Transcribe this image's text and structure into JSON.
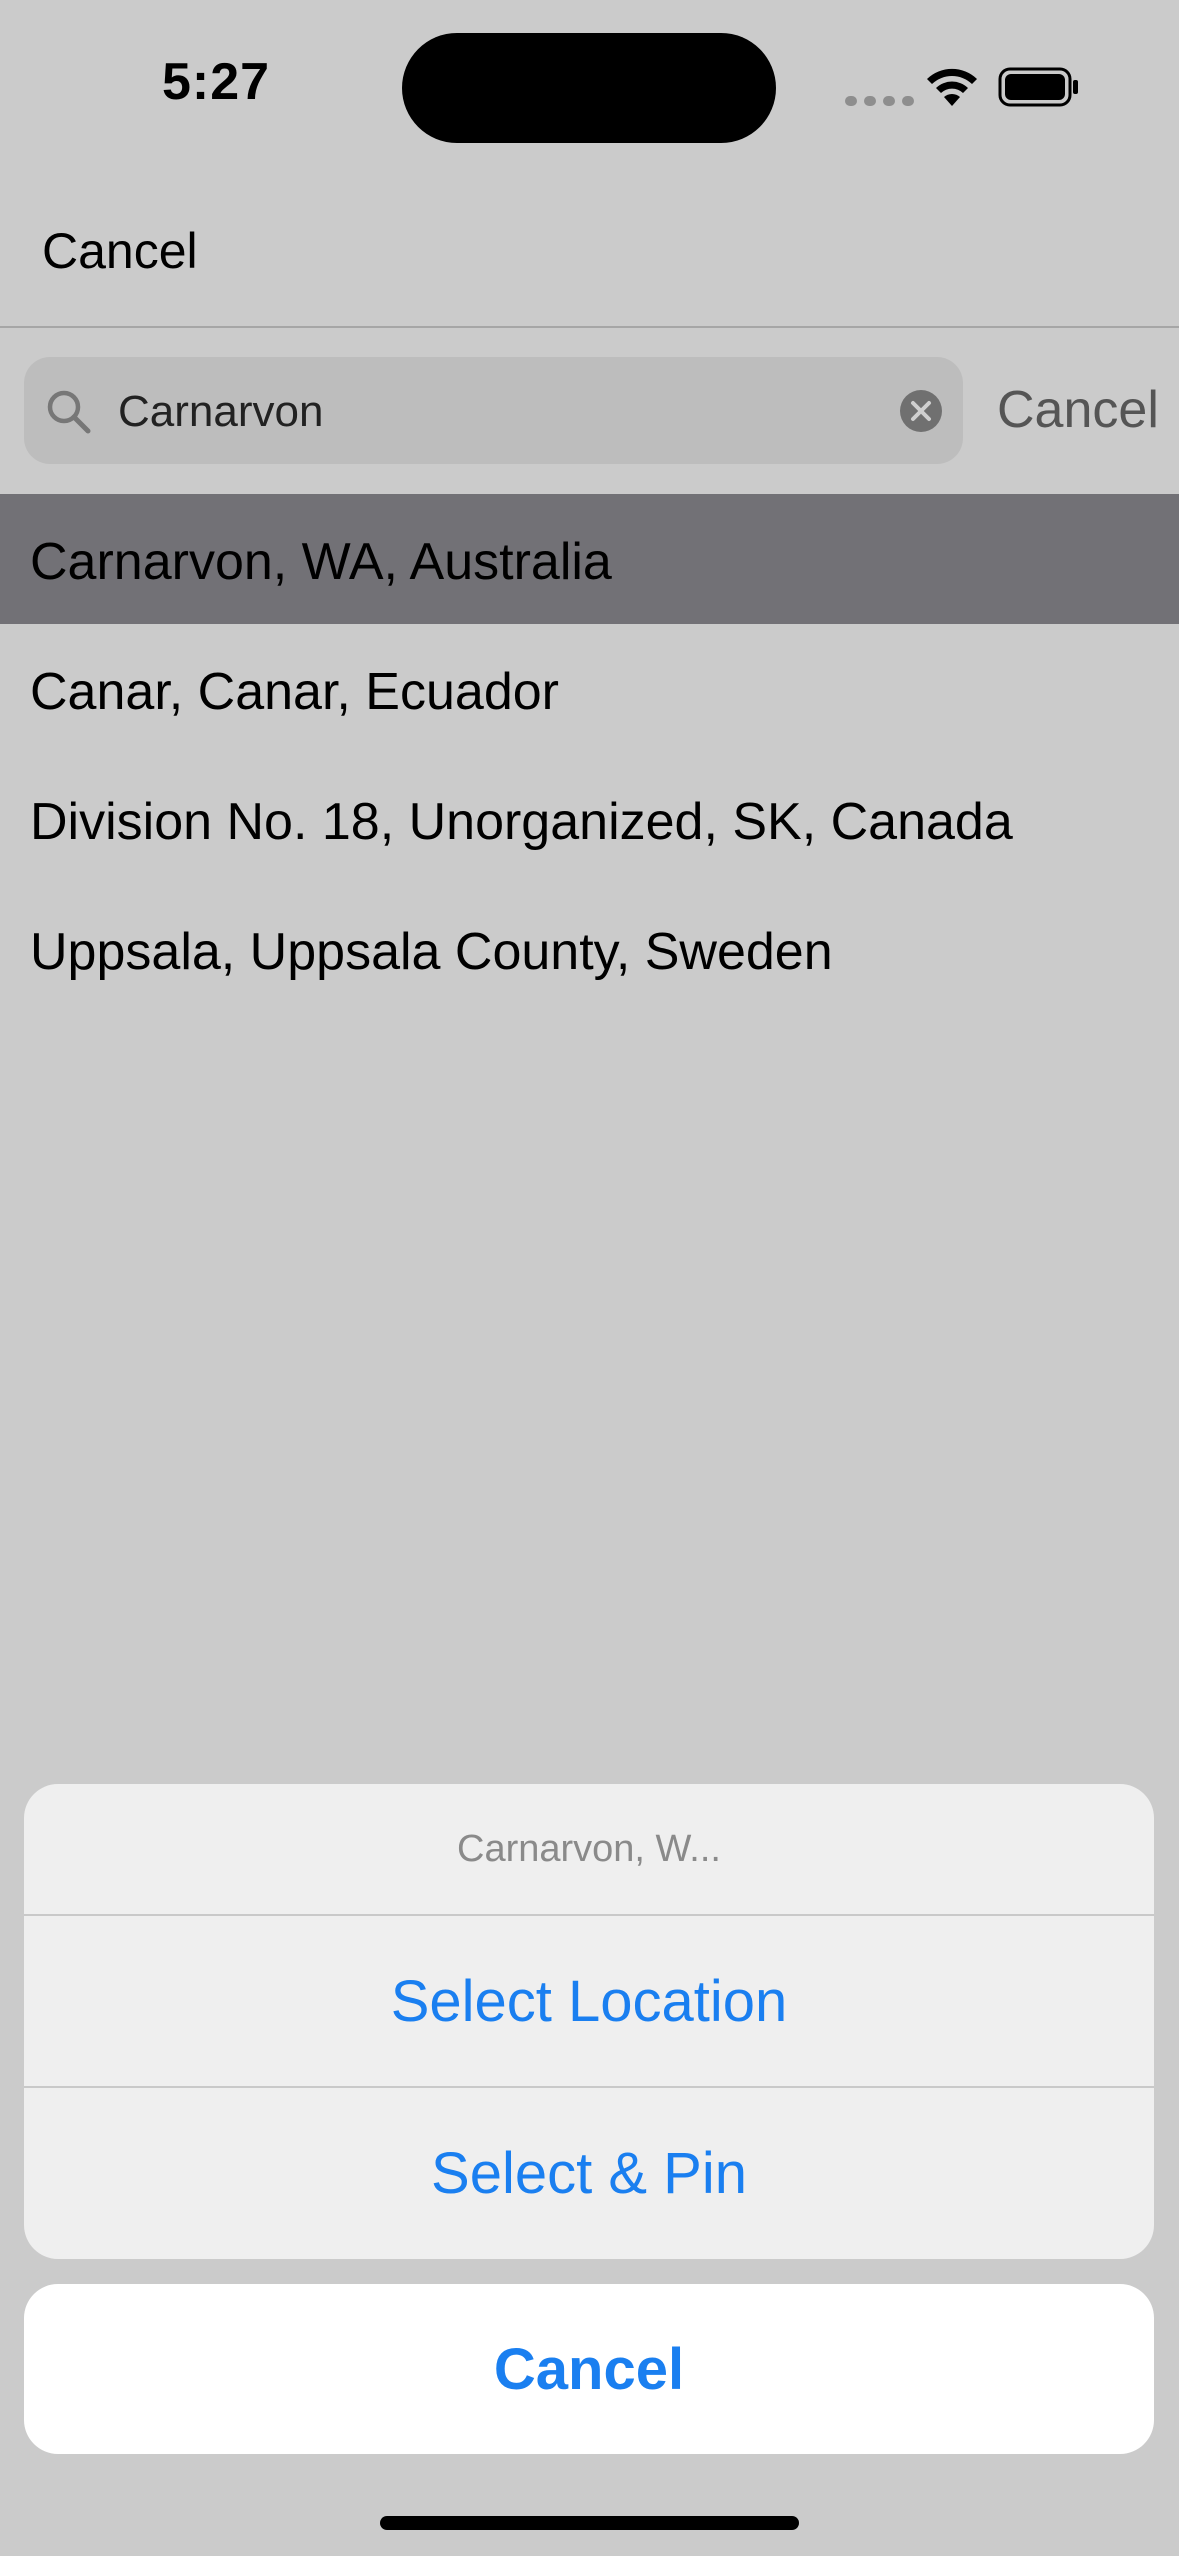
{
  "status_bar": {
    "time": "5:27"
  },
  "nav_bar": {
    "cancel_label": "Cancel"
  },
  "search": {
    "value": "Carnarvon",
    "cancel_label": "Cancel"
  },
  "results": [
    {
      "label": "Carnarvon, WA, Australia",
      "selected": true
    },
    {
      "label": "Canar, Canar, Ecuador",
      "selected": false
    },
    {
      "label": "Division No. 18, Unorganized, SK, Canada",
      "selected": false
    },
    {
      "label": "Uppsala, Uppsala County, Sweden",
      "selected": false
    }
  ],
  "action_sheet": {
    "title": "Carnarvon, W...",
    "select_location_label": "Select Location",
    "select_pin_label": "Select & Pin",
    "cancel_label": "Cancel"
  },
  "colors": {
    "accent": "#1a7ff0",
    "selected_row": "#727176",
    "background": "#cbcbcb"
  }
}
